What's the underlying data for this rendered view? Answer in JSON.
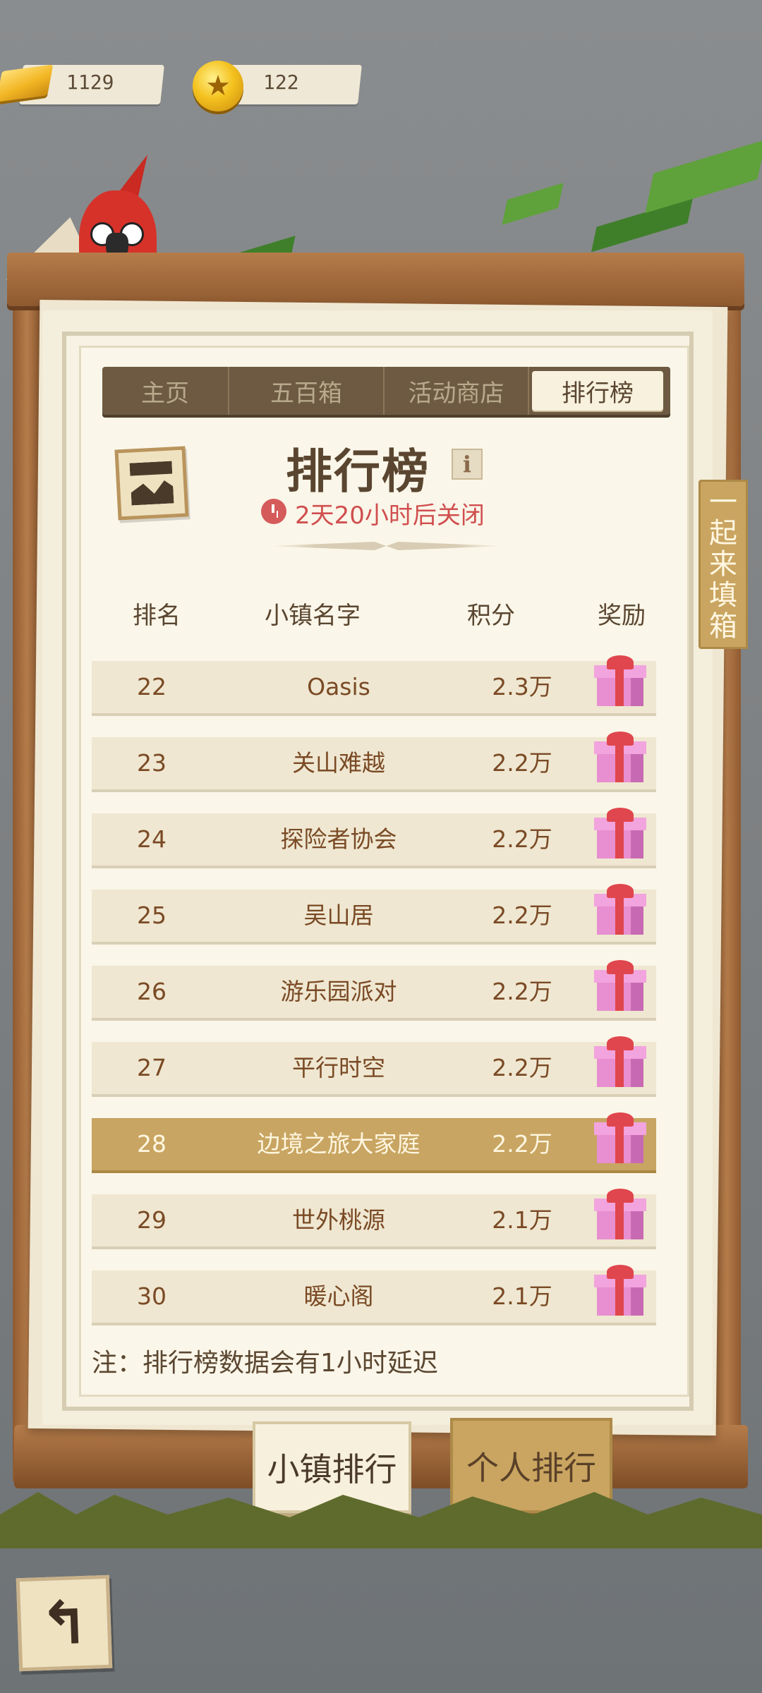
{
  "currency": {
    "gold": "1129",
    "coins": "122"
  },
  "tabs": [
    {
      "label": "主页",
      "active": false
    },
    {
      "label": "五百箱",
      "active": false
    },
    {
      "label": "活动商店",
      "active": false
    },
    {
      "label": "排行榜",
      "active": true
    }
  ],
  "header": {
    "title": "排行榜",
    "info_label": "i",
    "countdown": "2天20小时后关闭"
  },
  "table": {
    "columns": [
      "排名",
      "小镇名字",
      "积分",
      "奖励"
    ],
    "rows": [
      {
        "rank": "22",
        "name": "Oasis",
        "score": "2.3万",
        "highlight": false
      },
      {
        "rank": "23",
        "name": "关山难越",
        "score": "2.2万",
        "highlight": false
      },
      {
        "rank": "24",
        "name": "探险者协会",
        "score": "2.2万",
        "highlight": false
      },
      {
        "rank": "25",
        "name": "吴山居",
        "score": "2.2万",
        "highlight": false
      },
      {
        "rank": "26",
        "name": "游乐园派对",
        "score": "2.2万",
        "highlight": false
      },
      {
        "rank": "27",
        "name": "平行时空",
        "score": "2.2万",
        "highlight": false
      },
      {
        "rank": "28",
        "name": "边境之旅大家庭",
        "score": "2.2万",
        "highlight": true
      },
      {
        "rank": "29",
        "name": "世外桃源",
        "score": "2.1万",
        "highlight": false
      },
      {
        "rank": "30",
        "name": "暖心阁",
        "score": "2.1万",
        "highlight": false
      }
    ]
  },
  "note": "注：排行榜数据会有1小时延迟",
  "buttons": {
    "town_rank": "小镇排行",
    "personal_rank": "个人排行"
  },
  "side_tab": [
    "一",
    "起",
    "来",
    "填",
    "箱"
  ],
  "icons": {
    "back": "back-arrow-icon",
    "gift": "gift-box-icon",
    "clock": "clock-icon",
    "gold": "gold-bar-icon",
    "coin": "star-coin-icon"
  },
  "colors": {
    "highlight_row": "#c8a562",
    "countdown": "#d04f4f",
    "tab_bar": "#6e5a42"
  }
}
